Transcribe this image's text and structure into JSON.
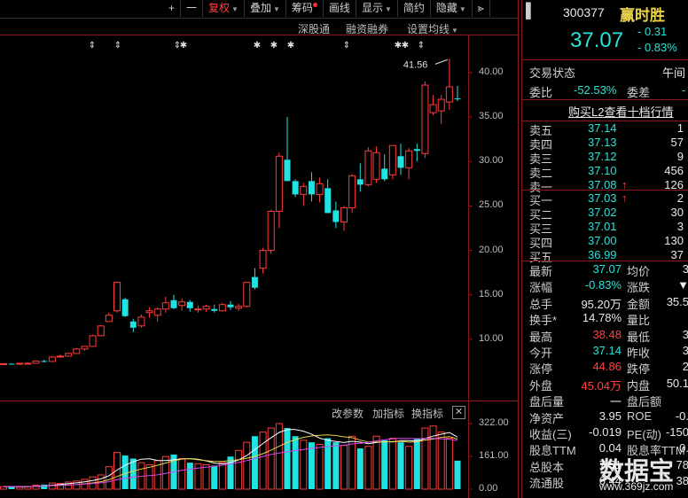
{
  "toolbar": {
    "items": [
      {
        "label": "+"
      },
      {
        "label": "一"
      },
      {
        "label": "复权",
        "caret": true,
        "active": true
      },
      {
        "label": "叠加",
        "caret": true
      },
      {
        "label": "筹码",
        "dot": true
      },
      {
        "label": "画线"
      },
      {
        "label": "显示",
        "caret": true
      },
      {
        "label": "简约"
      },
      {
        "label": "隐藏",
        "caret": true
      }
    ],
    "forward_icon": "double-chevron-right-icon"
  },
  "function_row": {
    "shenzhen_connect": "深股通",
    "margin_trading": "融资融券",
    "ma_settings": "设置均线"
  },
  "chart": {
    "y_labels": [
      "40.00",
      "35.00",
      "30.00",
      "25.00",
      "20.00",
      "15.00",
      "10.00"
    ],
    "high_marker": "41.56",
    "indicator_tabs": [
      "改参数",
      "加指标",
      "换指标"
    ],
    "close_icon": "close-box-icon",
    "volume_labels": [
      "322.00",
      "161.00",
      "0.00"
    ]
  },
  "chart_data": {
    "type": "candlestick",
    "y_range": [
      5,
      42
    ],
    "candles": [
      [
        7.2,
        7.3,
        7.1,
        7.25
      ],
      [
        7.25,
        7.3,
        7.2,
        7.2
      ],
      [
        7.2,
        7.3,
        7.1,
        7.3
      ],
      [
        7.3,
        7.4,
        7.2,
        7.3
      ],
      [
        7.3,
        7.6,
        7.3,
        7.55
      ],
      [
        7.55,
        7.7,
        7.4,
        7.5
      ],
      [
        7.5,
        8.1,
        7.5,
        8.0
      ],
      [
        8.0,
        8.3,
        7.9,
        8.1
      ],
      [
        8.1,
        8.5,
        8.1,
        8.4
      ],
      [
        8.4,
        9.0,
        8.4,
        8.9
      ],
      [
        8.9,
        9.2,
        8.7,
        9.2
      ],
      [
        9.2,
        10.5,
        9.2,
        10.4
      ],
      [
        10.4,
        11.6,
        10.4,
        11.5
      ],
      [
        12.0,
        13.0,
        12.0,
        12.7
      ],
      [
        13.2,
        16.5,
        13.0,
        16.4
      ],
      [
        14.5,
        14.7,
        12.5,
        12.6
      ],
      [
        12.0,
        12.3,
        10.8,
        11.3
      ],
      [
        11.5,
        12.8,
        11.3,
        12.5
      ],
      [
        13.0,
        13.6,
        12.4,
        13.2
      ],
      [
        12.7,
        13.6,
        12.0,
        13.4
      ],
      [
        13.4,
        14.8,
        13.0,
        14.1
      ],
      [
        14.4,
        15.0,
        13.4,
        13.5
      ],
      [
        13.8,
        14.6,
        13.2,
        14.2
      ],
      [
        14.2,
        14.4,
        13.1,
        13.5
      ],
      [
        13.4,
        13.8,
        13.0,
        13.4
      ],
      [
        13.4,
        13.9,
        13.1,
        13.7
      ],
      [
        13.4,
        13.9,
        13.0,
        13.2
      ],
      [
        13.2,
        14.1,
        13.1,
        13.9
      ],
      [
        13.9,
        14.3,
        13.3,
        13.6
      ],
      [
        13.5,
        14.0,
        13.2,
        13.7
      ],
      [
        13.7,
        16.0,
        13.6,
        16.4
      ],
      [
        17.0,
        18.0,
        15.6,
        15.8
      ],
      [
        18.0,
        20.3,
        17.4,
        20.0
      ],
      [
        20.0,
        24.6,
        19.6,
        24.4
      ],
      [
        24.4,
        31.0,
        22.5,
        30.6
      ],
      [
        30.2,
        35.0,
        28.6,
        27.8
      ],
      [
        27.8,
        28.0,
        26.0,
        26.3
      ],
      [
        26.3,
        27.6,
        25.0,
        27.2
      ],
      [
        27.8,
        28.8,
        25.5,
        26.3
      ],
      [
        26.3,
        28.2,
        25.4,
        27.5
      ],
      [
        27.0,
        28.0,
        25.2,
        24.2
      ],
      [
        24.5,
        25.5,
        22.5,
        23.2
      ],
      [
        23.2,
        25.0,
        22.2,
        24.8
      ],
      [
        24.8,
        28.6,
        24.2,
        28.4
      ],
      [
        28.0,
        29.8,
        26.6,
        27.4
      ],
      [
        27.4,
        31.6,
        27.2,
        31.2
      ],
      [
        28.0,
        31.7,
        27.6,
        31.0
      ],
      [
        29.2,
        30.8,
        27.8,
        28.0
      ],
      [
        28.5,
        31.8,
        28.0,
        31.8
      ],
      [
        30.6,
        32.0,
        28.5,
        29.3
      ],
      [
        29.3,
        31.5,
        28.0,
        31.2
      ],
      [
        31.4,
        32.0,
        30.0,
        31.2
      ],
      [
        30.9,
        39.0,
        30.4,
        38.6
      ],
      [
        35.5,
        37.5,
        35.2,
        36.4
      ],
      [
        35.7,
        37.5,
        34.2,
        37.0
      ],
      [
        36.7,
        41.56,
        35.8,
        38.4
      ],
      [
        37.1,
        38.5,
        36.8,
        37.07
      ]
    ],
    "volume_range": [
      0,
      322
    ],
    "volumes": [
      12,
      14,
      10,
      13,
      20,
      22,
      30,
      28,
      35,
      40,
      48,
      60,
      70,
      110,
      180,
      165,
      150,
      130,
      120,
      140,
      160,
      170,
      150,
      130,
      125,
      120,
      115,
      130,
      160,
      190,
      230,
      260,
      280,
      300,
      322,
      300,
      260,
      240,
      230,
      220,
      250,
      230,
      215,
      260,
      200,
      210,
      260,
      240,
      250,
      230,
      210,
      250,
      300,
      310,
      280,
      250,
      140
    ]
  },
  "quote": {
    "code": "300377",
    "name": "赢时胜",
    "price": "37.07",
    "change": "- 0.31",
    "change_pct": "- 0.83%"
  },
  "status": {
    "label": "交易状态",
    "value": "午间"
  },
  "ratio": {
    "weibi_label": "委比",
    "weibi_value": "-52.53%",
    "weicha_label": "委差",
    "weicha_value": "-"
  },
  "l2_link": "购买L2查看十档行情",
  "sell_orders": [
    {
      "label": "卖五",
      "price": "37.14",
      "vol": "1"
    },
    {
      "label": "卖四",
      "price": "37.13",
      "vol": "57"
    },
    {
      "label": "卖三",
      "price": "37.12",
      "vol": "9"
    },
    {
      "label": "卖二",
      "price": "37.10",
      "vol": "456"
    },
    {
      "label": "卖一",
      "price": "37.08",
      "vol": "126"
    }
  ],
  "buy_orders": [
    {
      "label": "买一",
      "price": "37.03",
      "vol": "2"
    },
    {
      "label": "买二",
      "price": "37.02",
      "vol": "30"
    },
    {
      "label": "买三",
      "price": "37.01",
      "vol": "3"
    },
    {
      "label": "买四",
      "price": "37.00",
      "vol": "130"
    },
    {
      "label": "买五",
      "price": "36.99",
      "vol": "37"
    }
  ],
  "stats": [
    {
      "l": "最新",
      "v": "37.07",
      "vc": "grn",
      "l2": "均价",
      "v2": "3"
    },
    {
      "l": "涨幅",
      "v": "-0.83%",
      "vc": "grn",
      "l2": "涨跌",
      "v2": "▼"
    },
    {
      "l": "总手",
      "v": "95.20万",
      "vc": "wht",
      "l2": "金额",
      "v2": "35.5"
    },
    {
      "l": "换手*",
      "v": "14.78%",
      "vc": "wht",
      "l2": "量比",
      "v2": ""
    },
    {
      "l": "最高",
      "v": "38.48",
      "vc": "red",
      "l2": "最低",
      "v2": "3"
    },
    {
      "l": "今开",
      "v": "37.14",
      "vc": "grn",
      "l2": "昨收",
      "v2": "3"
    },
    {
      "l": "涨停",
      "v": "44.86",
      "vc": "red",
      "l2": "跌停",
      "v2": "2"
    },
    {
      "l": "外盘",
      "v": "45.04万",
      "vc": "red",
      "l2": "内盘",
      "v2": "50.1"
    },
    {
      "l": "盘后量",
      "v": "一",
      "vc": "wht",
      "l2": "盘后额",
      "v2": ""
    },
    {
      "l": "净资产",
      "v": "3.95",
      "vc": "wht",
      "l2": "ROE",
      "v2": "-0."
    },
    {
      "l": "收益(三)",
      "v": "-0.019",
      "vc": "wht",
      "l2": "PE(动)",
      "v2": "-150"
    },
    {
      "l": "股息TTM",
      "v": "0.04",
      "vc": "wht",
      "l2": "股息率TTM",
      "v2": "0."
    },
    {
      "l": "总股本",
      "v": "7.51",
      "vc": "wht",
      "l2": "",
      "v2": "78"
    },
    {
      "l": "流通股",
      "v": "6.44",
      "vc": "wht",
      "l2": "",
      "v2": "38"
    }
  ],
  "watermark": {
    "text": "数据宝",
    "url": "www.369jz.com"
  }
}
